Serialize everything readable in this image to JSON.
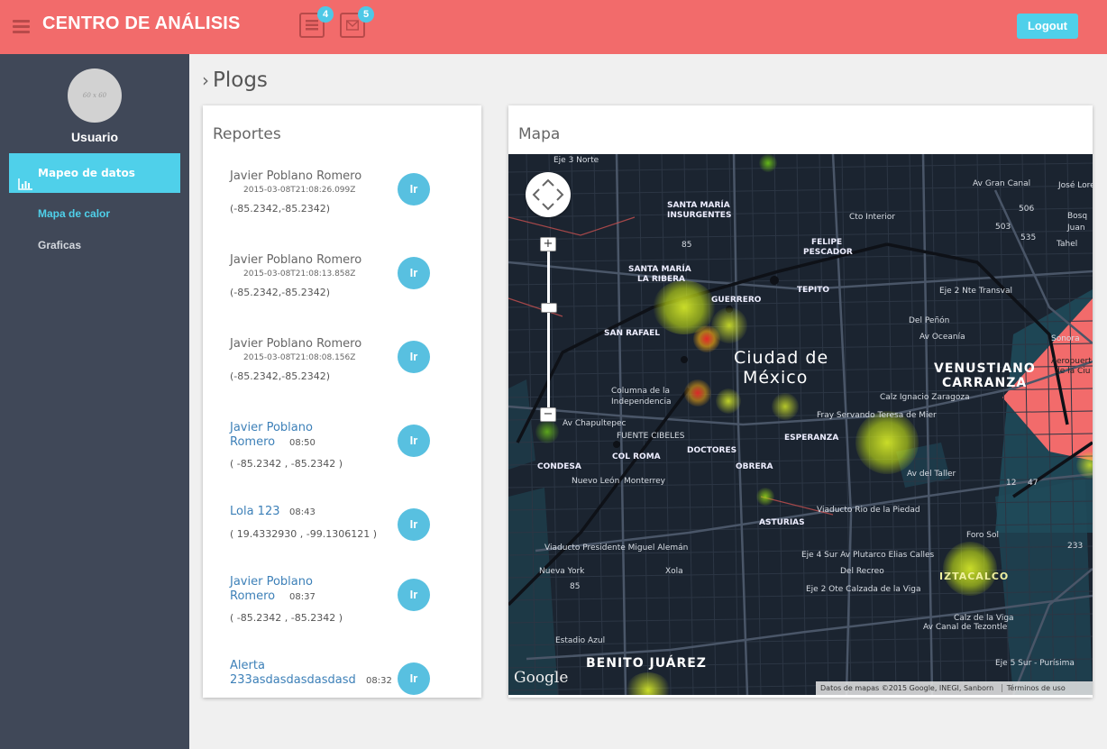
{
  "header": {
    "brand": "CENTRO DE ANÁLISIS",
    "icons": [
      {
        "name": "list-icon",
        "badge": "4"
      },
      {
        "name": "mail-icon",
        "badge": "5"
      }
    ],
    "logout_label": "Logout",
    "accent_color": "#f26b6b",
    "button_color": "#4fd0ea"
  },
  "sidebar": {
    "avatar_placeholder": "60 x 60",
    "username": "Usuario",
    "active_item": {
      "label": "Mapeo de datos",
      "icon": "bar-chart-icon"
    },
    "subitems": [
      {
        "label": "Mapa de calor",
        "active": true
      },
      {
        "label": "Graficas",
        "active": false
      }
    ],
    "bg_color": "#404858"
  },
  "page": {
    "title": "Plogs"
  },
  "reports": {
    "title": "Reportes",
    "button_label": "Ir",
    "items": [
      {
        "name": "Javier Poblano Romero",
        "date": "2015-03-08T21:08:26.099Z",
        "coords": "(-85.2342,-85.2342)"
      },
      {
        "name": "Javier Poblano Romero",
        "date": "2015-03-08T21:08:13.858Z",
        "coords": "(-85.2342,-85.2342)"
      },
      {
        "name": "Javier Poblano Romero",
        "date": "2015-03-08T21:08:08.156Z",
        "coords": "(-85.2342,-85.2342)"
      },
      {
        "name_line1": "Javier Poblano",
        "name_line2": "Romero",
        "time": "08:50",
        "coords": "( -85.2342 , -85.2342 )"
      },
      {
        "name_line1": "Lola 123",
        "time": "08:43",
        "coords": "( 19.4332930 , -99.1306121 )"
      },
      {
        "name_line1": "Javier Poblano",
        "name_line2": "Romero",
        "time": "08:37",
        "coords": "( -85.2342 , -85.2342 )"
      },
      {
        "name_line1": "Alerta",
        "name_line2": "233asdasdasdasdasd",
        "time": "08:32"
      }
    ]
  },
  "map": {
    "title": "Mapa",
    "zoom_in": "+",
    "zoom_out": "−",
    "google": "Google",
    "attribution": "Datos de mapas ©2015 Google, INEGI, Sanborn",
    "terms": "Términos de uso",
    "labels": {
      "city_line1": "Ciudad de",
      "city_line2": "México",
      "venustiano_line1": "VENUSTIANO",
      "venustiano_line2": "CARRANZA",
      "benito": "BENITO JUÁREZ",
      "iztacalco": "IZTACALCO",
      "aeropuerto_line1": "Aeropuert",
      "aeropuerto_line2": "de la Ciu",
      "santa_maria_ins_1": "SANTA MARÍA",
      "santa_maria_ins_2": "INSURGENTES",
      "santa_maria_rib_1": "SANTA MARÍA",
      "santa_maria_rib_2": "LA RIBERA",
      "felipe_1": "FELIPE",
      "felipe_2": "PESCADOR",
      "guerrero": "GUERRERO",
      "tepito": "TEPITO",
      "san_rafael": "SAN RAFAEL",
      "esperanza": "ESPERANZA",
      "doctores": "DOCTORES",
      "obrera": "OBRERA",
      "col_roma": "COL ROMA",
      "condesa": "CONDESA",
      "asturias": "ASTURIAS",
      "columna_1": "Columna de la",
      "columna_2": "Independencia",
      "fuente": "FUENTE CIBELES",
      "foro": "Foro Sol",
      "estadio": "Estadio Azul",
      "eje3": "Eje 3 Norte",
      "cto_interior": "Cto Interior",
      "eje2_nte": "Eje 2 Nte Transval",
      "av_oceania": "Av Oceanía",
      "del_penon": "Del Peñón",
      "fray": "Fray Servando Teresa de Mier",
      "viaducto_piedad": "Viaducto Rio de la Piedad",
      "viaducto_aleman": "Viaducto Presidente Miguel Alemán",
      "eje4": "Eje 4 Sur Av Plutarco Elias Calles",
      "del_recreo": "Del Recreo",
      "av_taller": "Av del Taller",
      "av_chapultepec": "Av Chapultepec",
      "av_tezontle": "Av Canal de Tezontle",
      "calz_zaragoza": "Calz Ignacio Zaragoza",
      "calz_viga": "Calz de la Viga",
      "eje_2_ote": "Eje 2 Ote Calzada de la Viga",
      "xola": "Xola",
      "sonora": "Sonora",
      "av_gran_canal": "Av Gran Canal",
      "jose_loreto": "José Loreto Fabela",
      "bosque": "Bosq",
      "juan": "Juan",
      "tahel": "Tahel",
      "monterrey": "Monterrey",
      "nuevo_leon": "Nuevo León",
      "nueva_york": "Nueva York",
      "purisima": "Eje 5 Sur - Purísima",
      "n85a": "85",
      "n85b": "85",
      "n503": "503",
      "n506": "506",
      "n535": "535",
      "n233": "233",
      "n12": "12",
      "n47": "47"
    }
  }
}
